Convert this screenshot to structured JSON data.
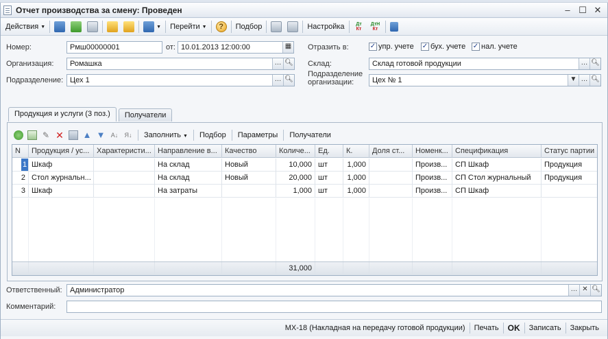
{
  "window": {
    "title": "Отчет производства за смену: Проведен"
  },
  "toolbar": {
    "actions_label": "Действия",
    "goto_label": "Перейти",
    "select_label": "Подбор",
    "settings_label": "Настройка",
    "dt_label": "Дт",
    "kt_label": "Кт",
    "dtn_label": "ДтН"
  },
  "form": {
    "number_label": "Номер:",
    "number_value": "Рмш00000001",
    "date_label": "от:",
    "date_value": "10.01.2013 12:00:00",
    "reflect_label": "Отразить в:",
    "checks": [
      {
        "label": "упр. учете",
        "checked": true
      },
      {
        "label": "бух. учете",
        "checked": true
      },
      {
        "label": "нал. учете",
        "checked": true
      }
    ],
    "org_label": "Организация:",
    "org_value": "Ромашка",
    "warehouse_label": "Склад:",
    "warehouse_value": "Склад готовой продукции",
    "division_label": "Подразделение:",
    "division_value": "Цех 1",
    "org_division_label_1": "Подразделение",
    "org_division_label_2": "организации:",
    "org_division_value": "Цех № 1",
    "responsible_label": "Ответственный:",
    "responsible_value": "Администратор",
    "comment_label": "Комментарий:",
    "comment_value": ""
  },
  "tabs": [
    {
      "label": "Продукция и услуги (3 поз.)",
      "active": true
    },
    {
      "label": "Получатели",
      "active": false
    }
  ],
  "subtoolbar": {
    "fill_label": "Заполнить",
    "select_label": "Подбор",
    "params_label": "Параметры",
    "recipients_label": "Получатели"
  },
  "table": {
    "columns": [
      "N",
      "Продукция / ус...",
      "Характеристи...",
      "Направление в...",
      "Качество",
      "Количе...",
      "Ед.",
      "К.",
      "Доля ст...",
      "Номенк...",
      "Спецификация",
      "Статус партии"
    ],
    "rows": [
      [
        "1",
        "Шкаф",
        "",
        "На склад",
        "Новый",
        "10,000",
        "шт",
        "1,000",
        "",
        "Произв...",
        "СП Шкаф",
        "Продукция"
      ],
      [
        "2",
        "Стол журнальн...",
        "",
        "На склад",
        "Новый",
        "20,000",
        "шт",
        "1,000",
        "",
        "Произв...",
        "СП Стол журнальный",
        "Продукция"
      ],
      [
        "3",
        "Шкаф",
        "",
        "На затраты",
        "",
        "1,000",
        "шт",
        "1,000",
        "",
        "Произв...",
        "СП Шкаф",
        ""
      ]
    ],
    "total_quantity": "31,000"
  },
  "statusbar": {
    "mx18_label": "МХ-18 (Накладная на передачу готовой продукции)",
    "print_label": "Печать",
    "ok_label": "OK",
    "save_label": "Записать",
    "close_label": "Закрыть"
  }
}
